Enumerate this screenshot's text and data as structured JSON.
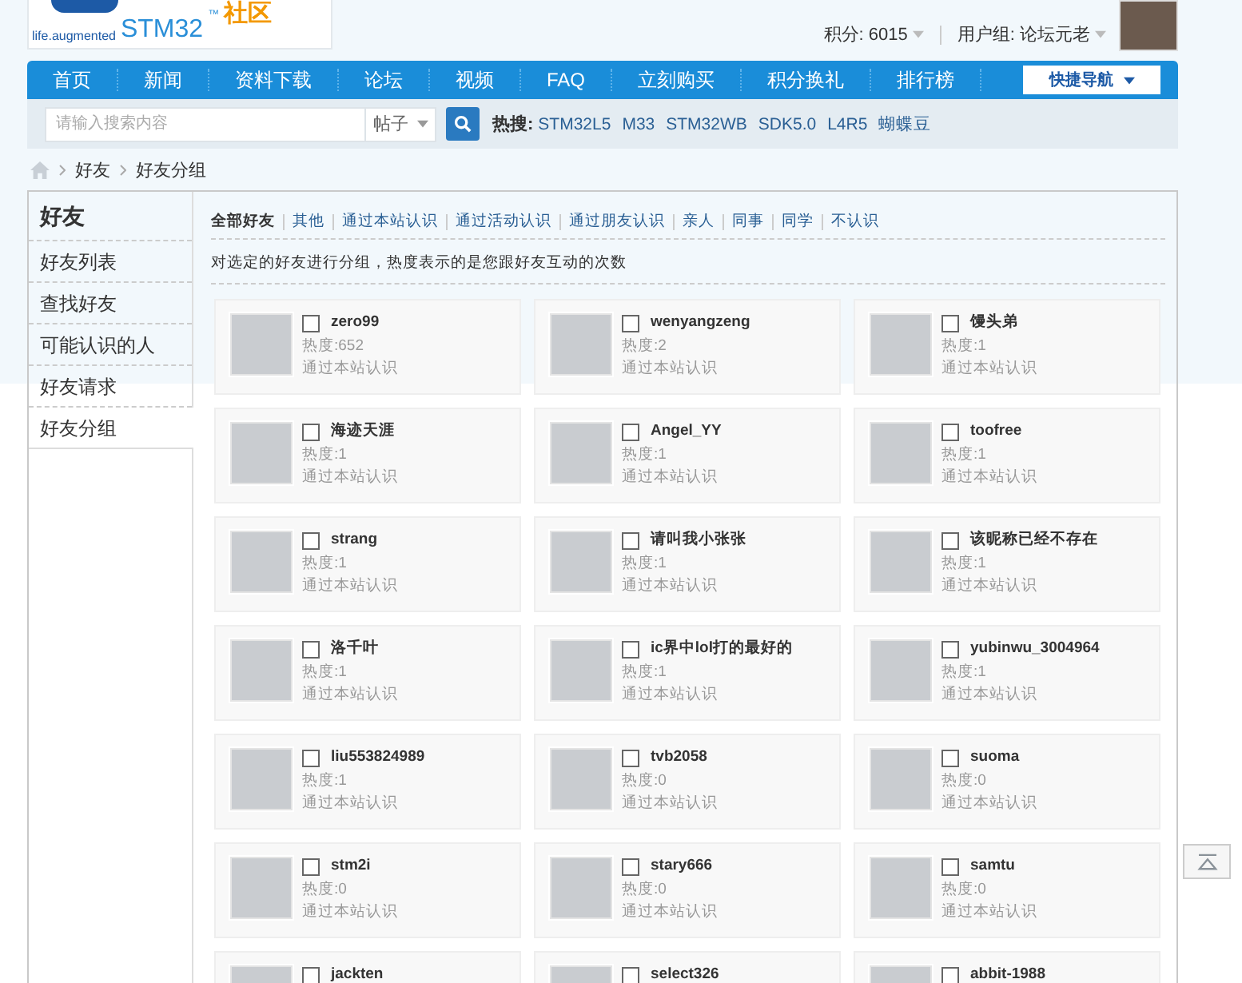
{
  "logo": {
    "tagline": "life.augmented",
    "brand": "STM32",
    "trademark": "™",
    "community": "社区"
  },
  "user_bar": {
    "points": "积分: 6015",
    "group": "用户组: 论坛元老"
  },
  "nav": {
    "items": [
      {
        "label": "首页"
      },
      {
        "label": "新闻"
      },
      {
        "label": "资料下载"
      },
      {
        "label": "论坛"
      },
      {
        "label": "视频"
      },
      {
        "label": "FAQ"
      },
      {
        "label": "立刻购买"
      },
      {
        "label": "积分换礼"
      },
      {
        "label": "排行榜"
      }
    ],
    "quick_nav": "快捷导航"
  },
  "search": {
    "placeholder": "请输入搜索内容",
    "scope": "帖子",
    "hot_label": "热搜:",
    "hot": [
      "STM32L5",
      "M33",
      "STM32WB",
      "SDK5.0",
      "L4R5",
      "蝴蝶豆"
    ]
  },
  "breadcrumb": [
    "好友",
    "好友分组"
  ],
  "sidebar": {
    "title": "好友",
    "items": [
      {
        "label": "好友列表",
        "selected": false
      },
      {
        "label": "查找好友",
        "selected": false
      },
      {
        "label": "可能认识的人",
        "selected": false
      },
      {
        "label": "好友请求",
        "selected": false
      },
      {
        "label": "好友分组",
        "selected": true
      }
    ]
  },
  "filters": [
    {
      "label": "全部好友",
      "selected": true
    },
    {
      "label": "其他",
      "selected": false
    },
    {
      "label": "通过本站认识",
      "selected": false
    },
    {
      "label": "通过活动认识",
      "selected": false
    },
    {
      "label": "通过朋友认识",
      "selected": false
    },
    {
      "label": "亲人",
      "selected": false
    },
    {
      "label": "同事",
      "selected": false
    },
    {
      "label": "同学",
      "selected": false
    },
    {
      "label": "不认识",
      "selected": false
    }
  ],
  "description": "对选定的好友进行分组，热度表示的是您跟好友互动的次数",
  "friends": [
    {
      "name": "zero99",
      "heat": "热度:652",
      "group": "通过本站认识",
      "checked": false
    },
    {
      "name": "wenyangzeng",
      "heat": "热度:2",
      "group": "通过本站认识",
      "checked": false
    },
    {
      "name": "馒头弟",
      "heat": "热度:1",
      "group": "通过本站认识",
      "checked": false
    },
    {
      "name": "海迹天涯",
      "heat": "热度:1",
      "group": "通过本站认识",
      "checked": false
    },
    {
      "name": "Angel_YY",
      "heat": "热度:1",
      "group": "通过本站认识",
      "checked": false
    },
    {
      "name": "toofree",
      "heat": "热度:1",
      "group": "通过本站认识",
      "checked": false
    },
    {
      "name": "strang",
      "heat": "热度:1",
      "group": "通过本站认识",
      "checked": false
    },
    {
      "name": "请叫我小张张",
      "heat": "热度:1",
      "group": "通过本站认识",
      "checked": false
    },
    {
      "name": "该昵称已经不存在",
      "heat": "热度:1",
      "group": "通过本站认识",
      "checked": false
    },
    {
      "name": "洛千叶",
      "heat": "热度:1",
      "group": "通过本站认识",
      "checked": false
    },
    {
      "name": "ic界中lol打的最好的",
      "heat": "热度:1",
      "group": "通过本站认识",
      "checked": false
    },
    {
      "name": "yubinwu_3004964",
      "heat": "热度:1",
      "group": "通过本站认识",
      "checked": false
    },
    {
      "name": "liu553824989",
      "heat": "热度:1",
      "group": "通过本站认识",
      "checked": false
    },
    {
      "name": "tvb2058",
      "heat": "热度:0",
      "group": "通过本站认识",
      "checked": false
    },
    {
      "name": "suoma",
      "heat": "热度:0",
      "group": "通过本站认识",
      "checked": false
    },
    {
      "name": "stm2i",
      "heat": "热度:0",
      "group": "通过本站认识",
      "checked": false
    },
    {
      "name": "stary666",
      "heat": "热度:0",
      "group": "通过本站认识",
      "checked": false
    },
    {
      "name": "samtu",
      "heat": "热度:0",
      "group": "通过本站认识",
      "checked": false
    },
    {
      "name": "jackten",
      "checked": false
    },
    {
      "name": "select326",
      "checked": false
    },
    {
      "name": "abbit-1988",
      "checked": false
    }
  ]
}
